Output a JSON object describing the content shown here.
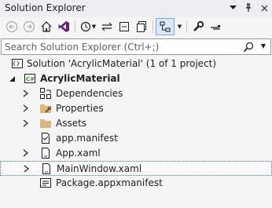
{
  "window": {
    "title": "Solution Explorer"
  },
  "search": {
    "placeholder": "Search Solution Explorer (Ctrl+;)"
  },
  "tree": {
    "solution": "Solution 'AcrylicMaterial' (1 of 1 project)",
    "project": "AcrylicMaterial",
    "items": [
      {
        "label": "Dependencies"
      },
      {
        "label": "Properties"
      },
      {
        "label": "Assets"
      },
      {
        "label": "app.manifest"
      },
      {
        "label": "App.xaml"
      },
      {
        "label": "MainWindow.xaml"
      },
      {
        "label": "Package.appxmanifest"
      }
    ]
  },
  "icons": {
    "back": "back-arrow-icon",
    "forward": "forward-arrow-icon",
    "home": "home-icon",
    "vs": "visual-studio-icon",
    "history": "history-icon",
    "sync": "sync-icon",
    "collapse": "collapse-all-icon",
    "showall": "show-all-files-icon",
    "preview": "preview-selected-icon",
    "properties": "wrench-icon",
    "search": "search-icon"
  },
  "colors": {
    "accent": "#3b78c4",
    "folder": "#dcb67a",
    "csproj": "#388a34"
  }
}
